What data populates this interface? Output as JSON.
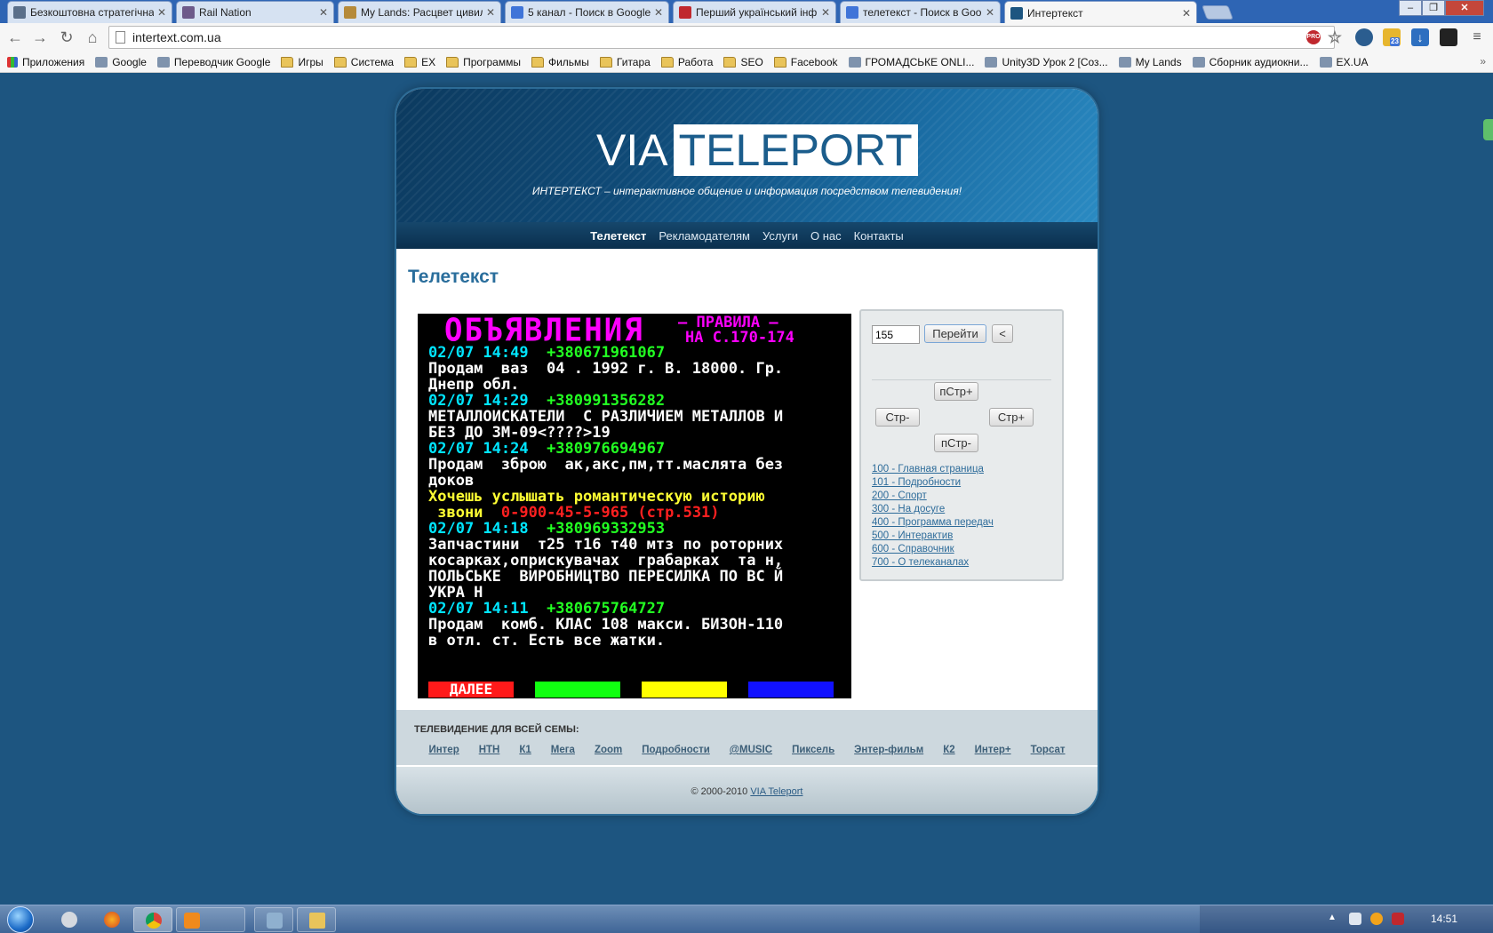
{
  "browser": {
    "tabs": [
      {
        "title": "Безкоштовна стратегічна",
        "favicon_color": "#5a6f8a"
      },
      {
        "title": "Rail Nation",
        "favicon_color": "#6d5a8a"
      },
      {
        "title": "My Lands: Расцвет цивил",
        "favicon_color": "#b58a3a"
      },
      {
        "title": "5 канал - Поиск в Google",
        "favicon_color": "#3f74d8"
      },
      {
        "title": "Перший український інф",
        "favicon_color": "#c0282e"
      },
      {
        "title": "телетекст - Поиск в Goog",
        "favicon_color": "#3f74d8"
      },
      {
        "title": "Интертекст",
        "favicon_color": "#1d5580"
      }
    ],
    "active_tab": 6,
    "url": "intertext.com.ua",
    "bookmarks": [
      "Приложения",
      "Google",
      "Переводчик Google",
      "Игры",
      "Система",
      "EX",
      "Программы",
      "Фильмы",
      "Гитара",
      "Работа",
      "SEO",
      "Facebook",
      "ГРОМАДСЬКЕ ONLI...",
      "Unity3D Урок 2 [Соз...",
      "My Lands",
      "Сборник аудиокни...",
      "EX.UA"
    ],
    "extension_badge": "23"
  },
  "site": {
    "logo_via": "VIA",
    "logo_teleport": "TELEPORT",
    "slogan": "ИНТЕРТЕКСТ – интерактивное общение и информация посредством телевидения!",
    "nav": [
      "Телетекст",
      "Рекламодателям",
      "Услуги",
      "О нас",
      "Контакты"
    ],
    "page_title": "Телетекст",
    "teletext": {
      "header": "ОБЪЯВЛЕНИЯ",
      "rules_1": "– ПРАВИЛА –",
      "rules_2": "НА С.170-174",
      "lines": [
        [
          {
            "t": "02/07 14:49  ",
            "c": "cyan"
          },
          {
            "t": "+380671961067",
            "c": "green"
          }
        ],
        [
          {
            "t": "Продам  ваз  04 . 1992 г. В. 18000. Гр.",
            "c": "white"
          }
        ],
        [
          {
            "t": "Днепр обл.",
            "c": "white"
          }
        ],
        [
          {
            "t": "02/07 14:29  ",
            "c": "cyan"
          },
          {
            "t": "+380991356282",
            "c": "green"
          }
        ],
        [
          {
            "t": "МЕТАЛЛОИСКАТЕЛИ  С РАЗЛИЧИЕМ МЕТАЛЛОВ И",
            "c": "white"
          }
        ],
        [
          {
            "t": "БЕЗ ДО ЗМ-09<????>19",
            "c": "white"
          }
        ],
        [
          {
            "t": "02/07 14:24  ",
            "c": "cyan"
          },
          {
            "t": "+380976694967",
            "c": "green"
          }
        ],
        [
          {
            "t": "Продам  зброю  ак,акс,пм,тт.маслята без",
            "c": "white"
          }
        ],
        [
          {
            "t": "доков",
            "c": "white"
          }
        ],
        [
          {
            "t": "Хочешь услышать романтическую историю",
            "c": "yellow"
          }
        ],
        [
          {
            "t": " звони  ",
            "c": "yellow"
          },
          {
            "t": "0-900-45-5-965 (стр.531)",
            "c": "red"
          }
        ],
        [
          {
            "t": "02/07 14:18  ",
            "c": "cyan"
          },
          {
            "t": "+380969332953",
            "c": "green"
          }
        ],
        [
          {
            "t": "Запчастини  т25 т16 т40 мтз по роторних",
            "c": "white"
          }
        ],
        [
          {
            "t": "косарках,оприскувачах  грабарках  та н,",
            "c": "white"
          }
        ],
        [
          {
            "t": "ПОЛЬСЬКЕ  ВИРОБНИЦТВО ПЕРЕСИЛКА ПО ВС Й",
            "c": "white"
          }
        ],
        [
          {
            "t": "УКРА Н",
            "c": "white"
          }
        ],
        [
          {
            "t": "02/07 14:11  ",
            "c": "cyan"
          },
          {
            "t": "+380675764727",
            "c": "green"
          }
        ],
        [
          {
            "t": "Продам  комб. КЛАС 108 макси. БИЗОН-110",
            "c": "white"
          }
        ],
        [
          {
            "t": "в отл. ст. Есть все жатки.",
            "c": "white"
          }
        ]
      ],
      "red_key": "ДАЛЕЕ"
    },
    "controls": {
      "page_input": "155",
      "go_label": "Перейти",
      "back_label": "<",
      "page_plus_label": "пСтр+",
      "page_minus_label": "пСтр-",
      "prev_label": "Стр-",
      "next_label": "Стр+",
      "links": [
        "100 - Главная страница",
        "101 - Подробности",
        "200 - Спорт",
        "300 - На досуге",
        "400 - Программа передач",
        "500 - Интерактив",
        "600 - Справочник",
        "700 - О телеканалах"
      ]
    },
    "footer": {
      "channels_label": "ТЕЛЕВИДЕНИЕ ДЛЯ ВСЕЙ СЕМЫ:",
      "channels": [
        "Интер",
        "НТН",
        "К1",
        "Мега",
        "Zoom",
        "Подробности",
        "@MUSIC",
        "Пиксель",
        "Энтер-фильм",
        "К2",
        "Интер+",
        "Торсат"
      ],
      "copyright_prefix": "© 2000-2010 ",
      "copyright_link": "VIA Teleport"
    }
  },
  "taskbar": {
    "clock": "14:51"
  }
}
